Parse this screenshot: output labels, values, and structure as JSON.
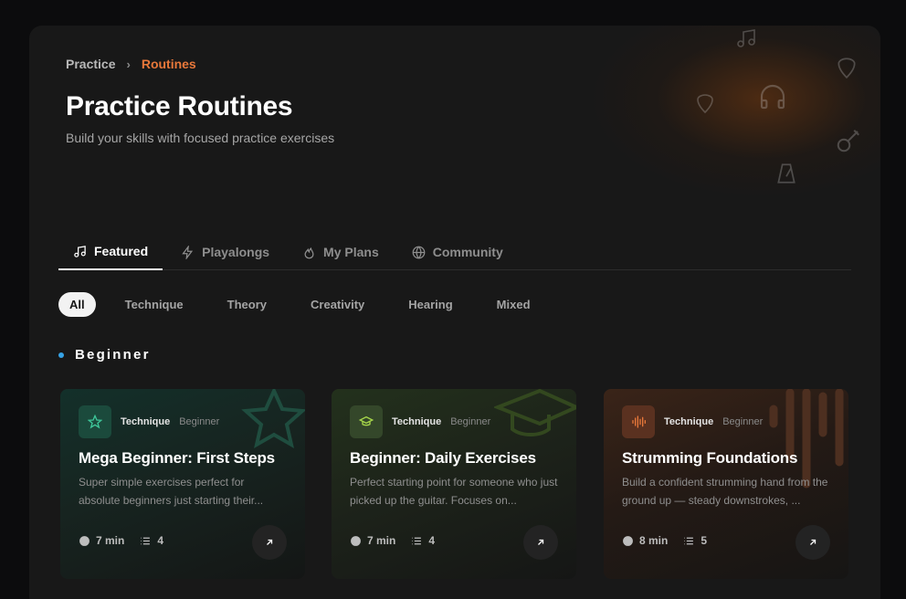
{
  "breadcrumb": {
    "home": "Practice",
    "separator": "›",
    "current": "Routines"
  },
  "header": {
    "title": "Practice Routines",
    "subtitle": "Build your skills with focused practice exercises"
  },
  "tabs": [
    {
      "label": "Featured",
      "icon": "music-note-icon",
      "active": true
    },
    {
      "label": "Playalongs",
      "icon": "lightning-icon",
      "active": false
    },
    {
      "label": "My Plans",
      "icon": "flame-icon",
      "active": false
    },
    {
      "label": "Community",
      "icon": "globe-icon",
      "active": false
    }
  ],
  "filters": [
    "All",
    "Technique",
    "Theory",
    "Creativity",
    "Hearing",
    "Mixed"
  ],
  "section": {
    "title": "Beginner",
    "dot_color": "#36a3e6"
  },
  "cards": [
    {
      "icon": "star-icon",
      "accent": "#3ec79a",
      "category": "Technique",
      "level": "Beginner",
      "title": "Mega Beginner: First Steps",
      "description": "Super simple exercises perfect for absolute beginners just starting their...",
      "duration": "7 min",
      "count": "4"
    },
    {
      "icon": "graduation-cap-icon",
      "accent": "#a6d64a",
      "category": "Technique",
      "level": "Beginner",
      "title": "Beginner: Daily Exercises",
      "description": "Perfect starting point for someone who just picked up the guitar. Focuses on...",
      "duration": "7 min",
      "count": "4"
    },
    {
      "icon": "audio-waveform-icon",
      "accent": "#e8783a",
      "category": "Technique",
      "level": "Beginner",
      "title": "Strumming Foundations",
      "description": "Build a confident strumming hand from the ground up — steady downstrokes, ...",
      "duration": "8 min",
      "count": "5"
    }
  ],
  "colors": {
    "accent_orange": "#e8783a",
    "background": "#0c0c0d",
    "panel": "#181818"
  }
}
